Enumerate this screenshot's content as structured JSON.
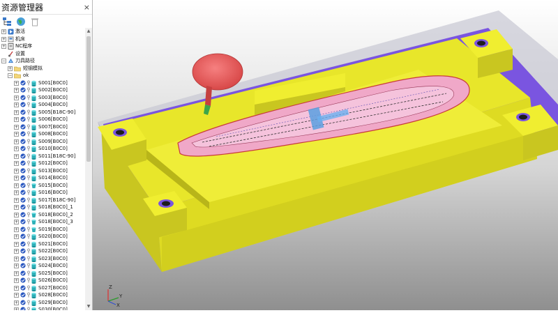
{
  "explorer": {
    "title": "资源管理器",
    "close_glyph": "×",
    "tree": {
      "top_items": [
        {
          "label": "激活",
          "icon": "activate-icon"
        },
        {
          "label": "机床",
          "icon": "machine-icon"
        },
        {
          "label": "NC程序",
          "icon": "nc-program-icon"
        },
        {
          "label": "设置",
          "icon": "settings-icon"
        }
      ],
      "toolpath_root": {
        "label": "刀具路径",
        "icon": "toolpath-folder-icon"
      },
      "folders": [
        {
          "label": "短钢模拟"
        },
        {
          "label": "ok"
        }
      ],
      "toolpaths": [
        "S001[B0C0]",
        "S002[B0C0]",
        "S003[B0C0]",
        "S004[B0C0]",
        "S005[B18C-90]",
        "S006[B0C0]",
        "S007[B0C0]",
        "S008[B0C0]",
        "S009[B0C0]",
        "S010[B0C0]",
        "S011[B18C-90]",
        "S012[B0C0]",
        "S013[B0C0]",
        "S014[B0C0]",
        "S015[B0C0]",
        "S016[B0C0]",
        "S017[B18C-90]",
        "S018[B0C0]_1",
        "S018[B0C0]_2",
        "S018[B0C0]_3",
        "S019[B0C0]",
        "S020[B0C0]",
        "S021[B0C0]",
        "S022[B0C0]",
        "S023[B0C0]",
        "S024[B0C0]",
        "S025[B0C0]",
        "S026[B0C0]",
        "S027[B0C0]",
        "S028[B0C0]",
        "S029[B0C0]",
        "S030[B0C0]"
      ]
    }
  },
  "viewport": {
    "axis_labels": {
      "z": "Z",
      "y": "Y",
      "x": "X"
    },
    "colors": {
      "mold_yellow": "#e8e62a",
      "mold_dark": "#b8b519",
      "purple": "#7a55e0",
      "part_pink": "#f0a8c8",
      "tool_red": "#ee6a6a",
      "stock_gray": "#b9b9c9"
    }
  }
}
